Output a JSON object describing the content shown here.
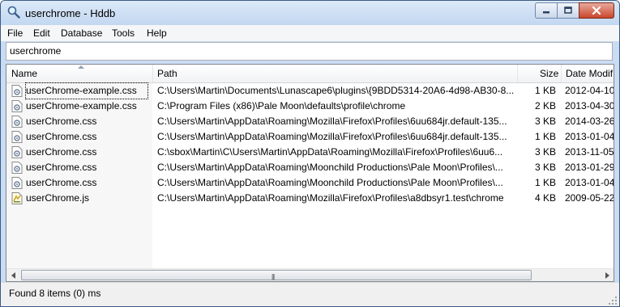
{
  "window": {
    "title": "userchrome - Hddb"
  },
  "menu": [
    "File",
    "Edit",
    "Database",
    "Tools",
    "Help"
  ],
  "search": {
    "value": "userchrome"
  },
  "columns": {
    "name": "Name",
    "path": "Path",
    "size": "Size",
    "date": "Date Modif"
  },
  "rows": [
    {
      "icon": "css-file-icon",
      "name": "userChrome-example.css",
      "path": "C:\\Users\\Martin\\Documents\\Lunascape6\\plugins\\{9BDD5314-20A6-4d98-AB30-8...",
      "size": "1 KB",
      "date": "2012-04-10"
    },
    {
      "icon": "css-file-icon",
      "name": "userChrome-example.css",
      "path": "C:\\Program Files (x86)\\Pale Moon\\defaults\\profile\\chrome",
      "size": "2 KB",
      "date": "2013-04-30"
    },
    {
      "icon": "css-file-icon",
      "name": "userChrome.css",
      "path": "C:\\Users\\Martin\\AppData\\Roaming\\Mozilla\\Firefox\\Profiles\\6uu684jr.default-135...",
      "size": "3 KB",
      "date": "2014-03-26"
    },
    {
      "icon": "css-file-icon",
      "name": "userChrome.css",
      "path": "C:\\Users\\Martin\\AppData\\Roaming\\Mozilla\\Firefox\\Profiles\\6uu684jr.default-135...",
      "size": "1 KB",
      "date": "2013-01-04"
    },
    {
      "icon": "css-file-icon",
      "name": "userChrome.css",
      "path": "C:\\sbox\\Martin\\C\\Users\\Martin\\AppData\\Roaming\\Mozilla\\Firefox\\Profiles\\6uu6...",
      "size": "3 KB",
      "date": "2013-11-05"
    },
    {
      "icon": "css-file-icon",
      "name": "userChrome.css",
      "path": "C:\\Users\\Martin\\AppData\\Roaming\\Moonchild Productions\\Pale Moon\\Profiles\\...",
      "size": "3 KB",
      "date": "2013-01-29"
    },
    {
      "icon": "css-file-icon",
      "name": "userChrome.css",
      "path": "C:\\Users\\Martin\\AppData\\Roaming\\Moonchild Productions\\Pale Moon\\Profiles\\...",
      "size": "1 KB",
      "date": "2013-01-04"
    },
    {
      "icon": "js-file-icon",
      "name": "userChrome.js",
      "path": "C:\\Users\\Martin\\AppData\\Roaming\\Mozilla\\Firefox\\Profiles\\a8dbsyr1.test\\chrome",
      "size": "4 KB",
      "date": "2009-05-22"
    }
  ],
  "scrollbar": {
    "grip": "|||"
  },
  "status": "Found 8 items (0) ms",
  "colors": {
    "titlebar": "#c2d7f1",
    "close_button": "#c9462c",
    "selection_outline": "#000000"
  }
}
